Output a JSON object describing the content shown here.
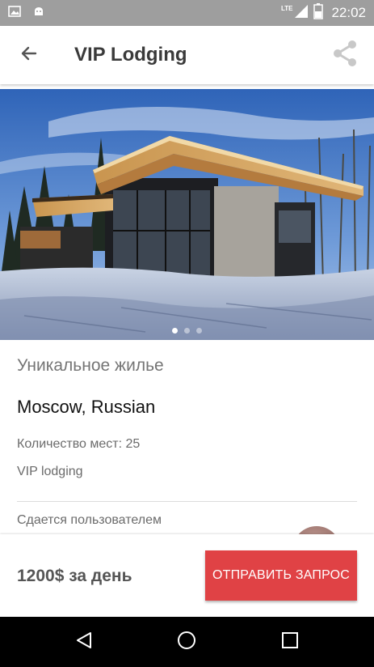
{
  "status_bar": {
    "network": "LTE",
    "time": "22:02",
    "icons": [
      "image-icon",
      "android-icon",
      "signal-icon",
      "battery-icon"
    ]
  },
  "toolbar": {
    "title": "VIP Lodging",
    "back_icon": "arrow-back-icon",
    "share_icon": "share-icon"
  },
  "gallery": {
    "page_count": 3,
    "active_page": 1
  },
  "details": {
    "subtitle": "Уникальное жилье",
    "location": "Moscow, Russian",
    "capacity": "Количество мест: 25",
    "category": "VIP lodging",
    "host_label": "Сдается пользователем"
  },
  "footer": {
    "price": "1200$ за день",
    "request_button": "ОТПРАВИТЬ ЗАПРОС"
  },
  "colors": {
    "accent": "#e04245",
    "status_bar": "#9e9e9e",
    "title_text": "#3a3a3a"
  }
}
